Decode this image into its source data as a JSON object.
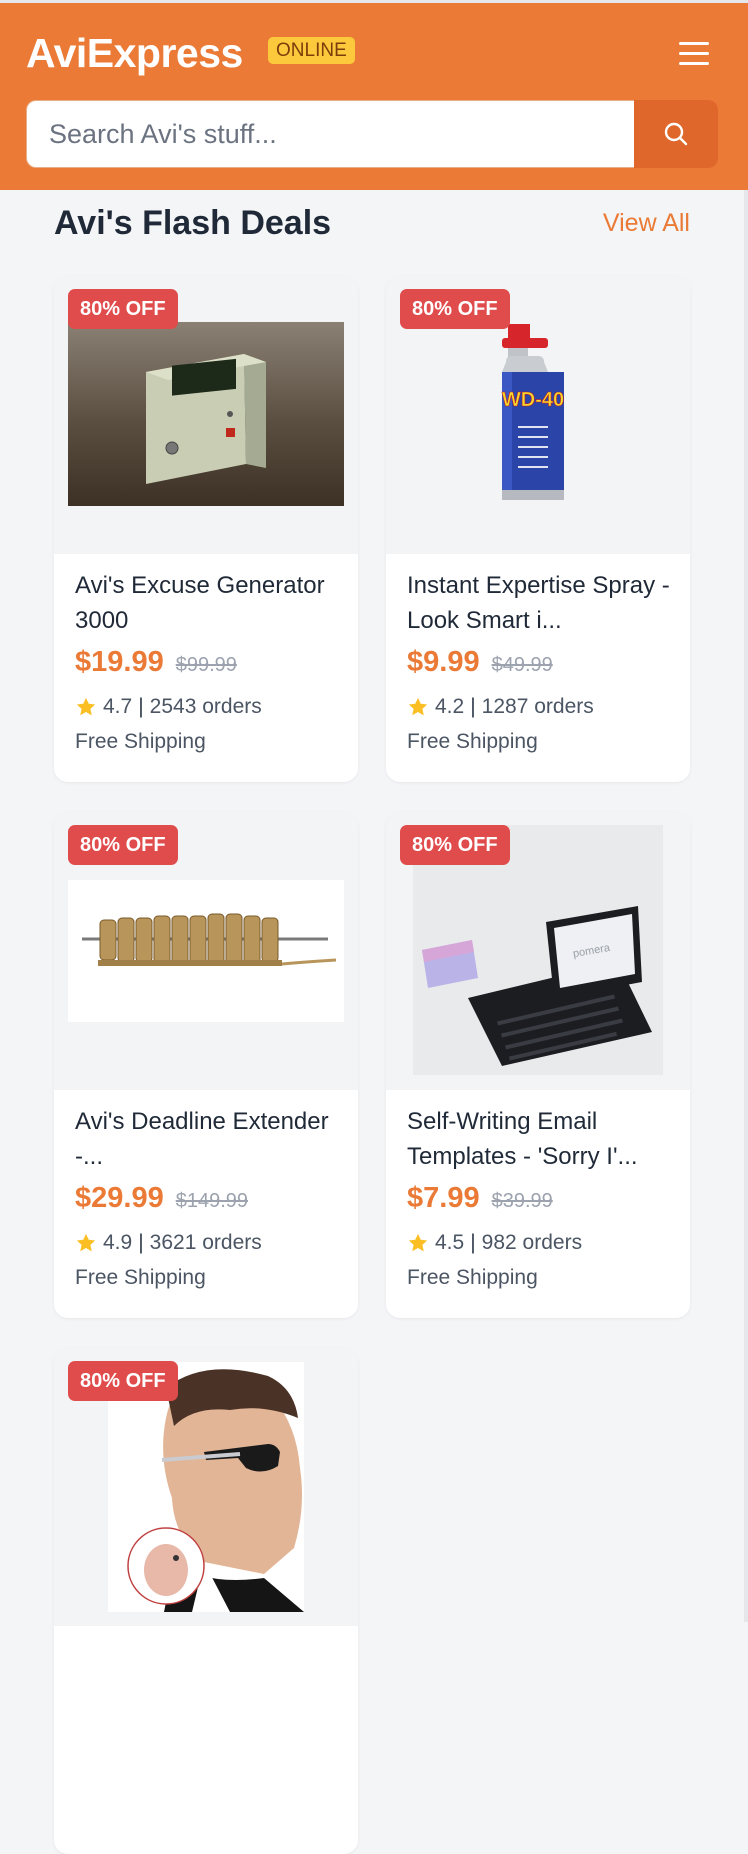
{
  "header": {
    "logo": "AviExpress",
    "status_badge": "ONLINE",
    "search_placeholder": "Search Avi's stuff..."
  },
  "section": {
    "title": "Avi's Flash Deals",
    "view_all": "View All"
  },
  "colors": {
    "brand": "#ea7a35",
    "badge": "#fcc93d",
    "discount": "#e04b4b",
    "star": "#fbbf24"
  },
  "products": [
    {
      "discount": "80% OFF",
      "title": "Avi's Excuse Generator 3000",
      "price": "$19.99",
      "old_price": "$99.99",
      "rating": "4.7",
      "orders": "2543 orders",
      "shipping": "Free Shipping",
      "image": "beige box with LCD display"
    },
    {
      "discount": "80% OFF",
      "title": "Instant Expertise Spray - Look Smart i...",
      "price": "$9.99",
      "old_price": "$49.99",
      "rating": "4.2",
      "orders": "1287 orders",
      "shipping": "Free Shipping",
      "image": "WD-40 spray can",
      "image_text": "WD-40"
    },
    {
      "discount": "80% OFF",
      "title": "Avi's Deadline Extender -...",
      "price": "$29.99",
      "old_price": "$149.99",
      "rating": "4.9",
      "orders": "3621 orders",
      "shipping": "Free Shipping",
      "image": "brass cipher rotor mechanism"
    },
    {
      "discount": "80% OFF",
      "title": "Self-Writing Email Templates - 'Sorry I'...",
      "price": "$7.99",
      "old_price": "$39.99",
      "rating": "4.5",
      "orders": "982 orders",
      "shipping": "Free Shipping",
      "image": "portable typewriter with screen",
      "image_text": "pomera"
    },
    {
      "discount": "80% OFF",
      "title": "",
      "image": "man in sunglasses with earpiece inset"
    }
  ]
}
